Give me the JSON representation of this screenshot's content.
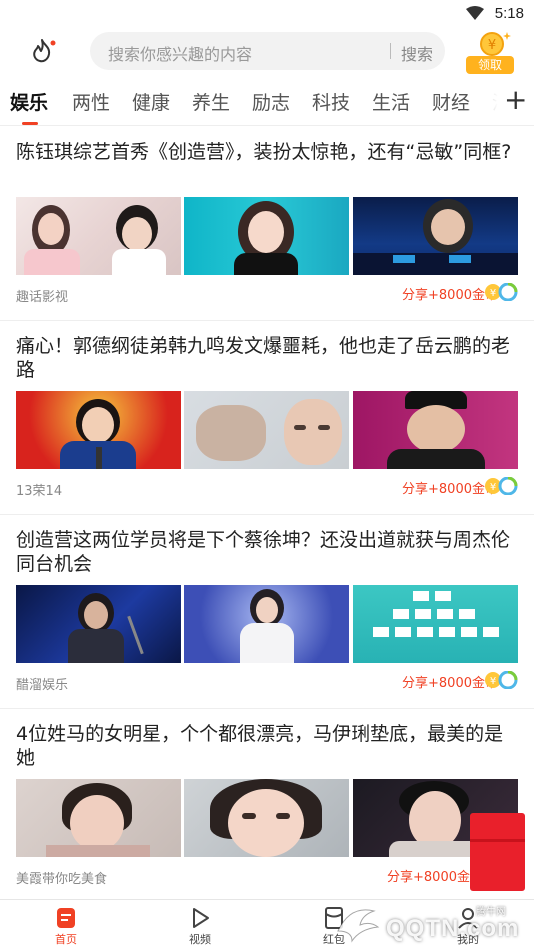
{
  "status_bar": {
    "time": "5:18",
    "icons": [
      "wifi-icon"
    ]
  },
  "header": {
    "search_placeholder": "搜索你感兴趣的内容",
    "search_button": "搜索",
    "coin_badge_label": "领取",
    "coin_symbol": "¥"
  },
  "tabs": [
    "娱乐",
    "两性",
    "健康",
    "养生",
    "励志",
    "科技",
    "生活",
    "财经",
    "汽"
  ],
  "active_tab": "娱乐",
  "articles": [
    {
      "title": "陈钰琪综艺首秀《创造营》，装扮太惊艳，还有“忌敏”同框?",
      "source": "趣话影视",
      "share": "分享+8000金币"
    },
    {
      "title": "痛心！郭德纲徒弟韩九鸣发文爆噩耗，他也走了岳云鹏的老路",
      "source": "13荣14",
      "share": "分享+8000金币"
    },
    {
      "title": "创造营这两位学员将是下个蔡徐坤？还没出道就获与周杰伦同台机会",
      "source": "醋溜娱乐",
      "share": "分享+8000金币"
    },
    {
      "title": "4位姓马的女明星，个个都很漂亮，马伊琍垫底，最美的是她",
      "source": "美霞带你吃美食",
      "share": "分享+8000金"
    }
  ],
  "bottom_nav": [
    {
      "label": "首页",
      "icon": "home-doc-icon",
      "active": true
    },
    {
      "label": "视频",
      "icon": "play-icon",
      "active": false
    },
    {
      "label": "红包",
      "icon": "envelope-icon",
      "active": false
    },
    {
      "label": "我的",
      "icon": "profile-icon",
      "active": false
    }
  ],
  "watermark": {
    "text": "QQTN.com",
    "sub": "腾牛网"
  },
  "colors": {
    "accent": "#f04124",
    "coin": "#ffb21e",
    "red_packet": "#e9202b"
  }
}
